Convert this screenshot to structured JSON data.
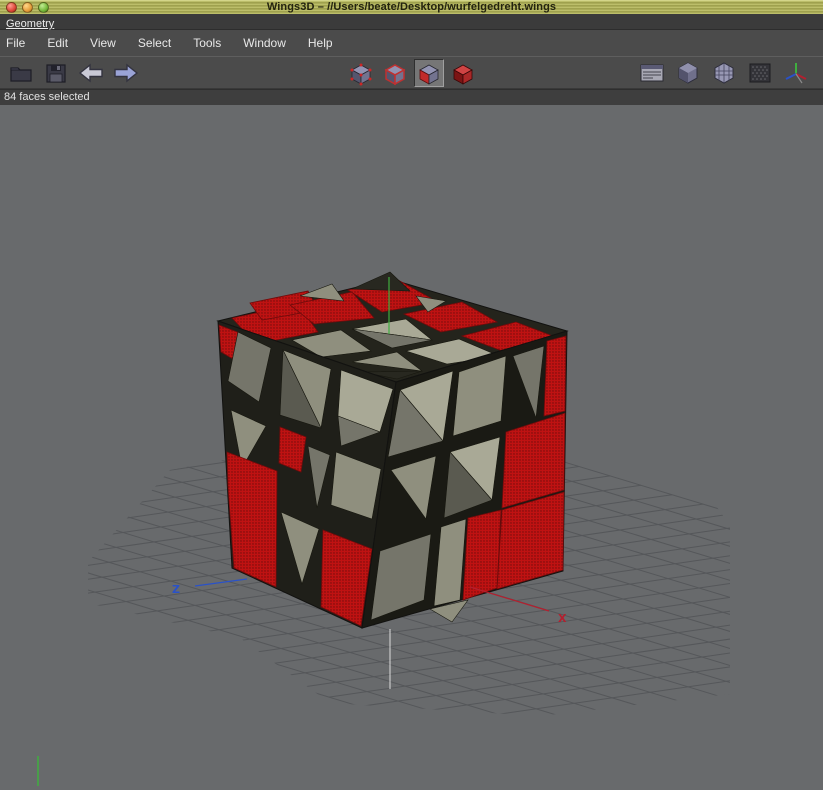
{
  "window": {
    "title": "Wings3D – //Users/beate/Desktop/wurfelgedreht.wings",
    "traffic_lights": [
      "close",
      "minimize",
      "zoom"
    ]
  },
  "geometry_bar": {
    "label": "Geometry"
  },
  "menu": {
    "items": [
      "File",
      "Edit",
      "View",
      "Select",
      "Tools",
      "Window",
      "Help"
    ]
  },
  "toolbar": {
    "file_tools": [
      "open",
      "save",
      "undo",
      "redo"
    ],
    "selection_modes": [
      {
        "name": "vertex",
        "active": false
      },
      {
        "name": "edge",
        "active": false
      },
      {
        "name": "face",
        "active": true
      },
      {
        "name": "body",
        "active": false
      }
    ],
    "view_tools": [
      "toggle-geometry-windows",
      "shaded-preview",
      "wireframe-preview",
      "ground-plane",
      "show-axes"
    ]
  },
  "status_bar": {
    "text": "84 faces selected"
  },
  "viewport": {
    "axes": {
      "x_label": "X",
      "z_label": "Z"
    },
    "colors": {
      "background": "#686a6c",
      "grid": "#55575a",
      "selection_red": "#bf1212",
      "face_khaki": "#9a9a8a",
      "axis_x": "#b3202f",
      "axis_y": "#3fae3f",
      "axis_z": "#2a52c8"
    }
  }
}
